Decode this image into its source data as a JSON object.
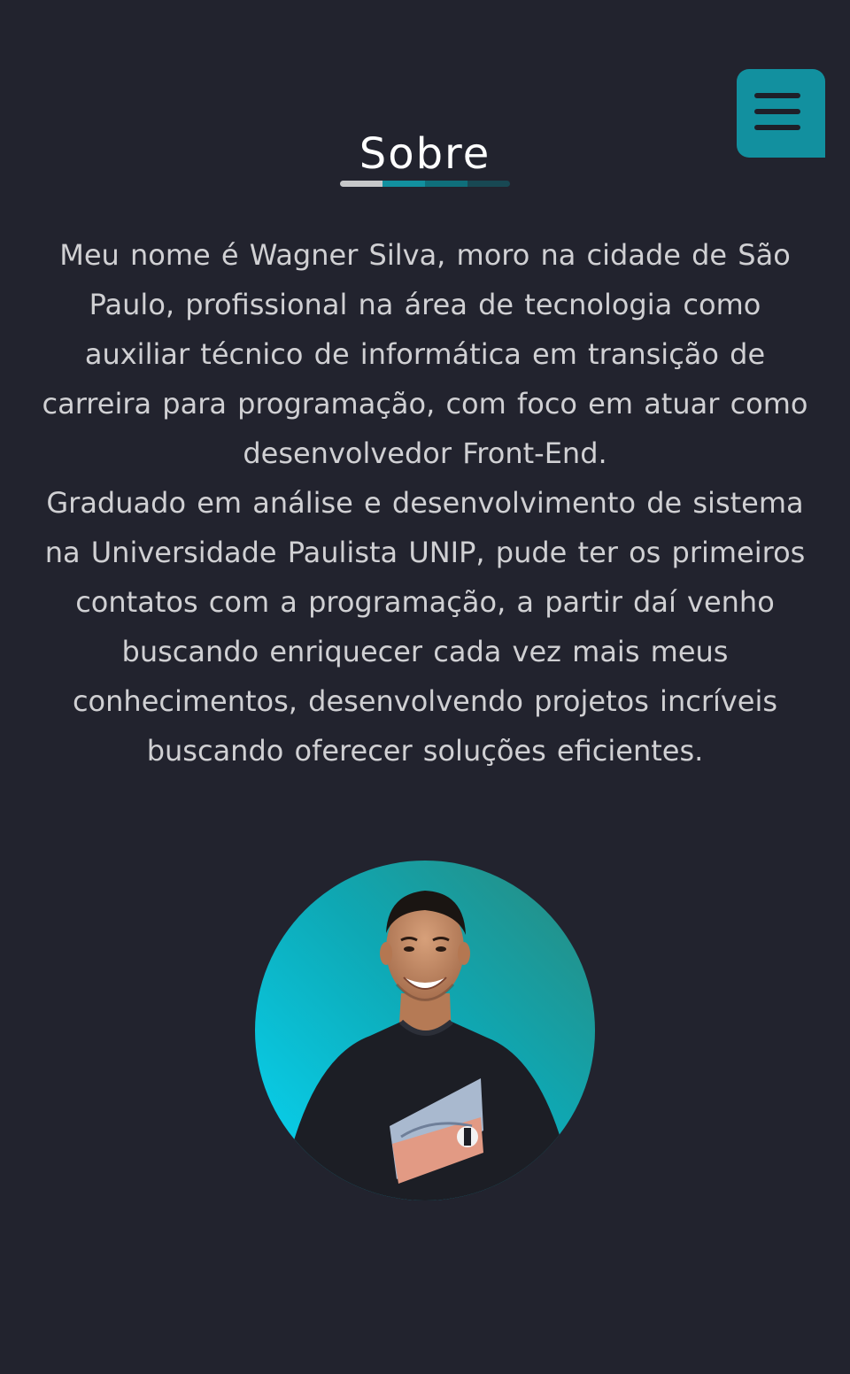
{
  "nav": {
    "menu_icon": "hamburger-menu-icon"
  },
  "about": {
    "title": "Sobre",
    "underline_colors": [
      "#c6c7c9",
      "#12909f",
      "#0f6f7b",
      "#184853"
    ],
    "paragraph_1": "Meu nome é Wagner Silva, moro na cidade de São Paulo, profissional na área de tecnologia como auxiliar técnico de informática em transição de carreira para programação, com foco em atuar como desenvolvedor Front-End.",
    "paragraph_2": "Graduado em análise e desenvolvimento de sistema na Universidade Paulista UNIP, pude ter os primeiros contatos com a programação, a partir daí venho buscando enriquecer cada vez mais meus conhecimentos, desenvolvendo projetos incríveis buscando oferecer soluções eficientes."
  },
  "colors": {
    "background": "#22232e",
    "accent": "#12909f",
    "title": "#ffffff",
    "text": "#d0d0d3"
  }
}
